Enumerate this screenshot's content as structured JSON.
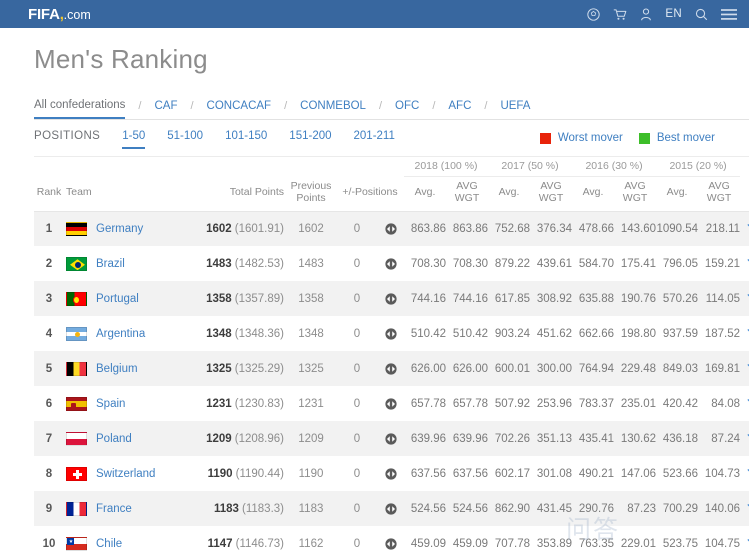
{
  "topbar": {
    "logo_fifa": "FIFA",
    "logo_comma": ",",
    "logo_com": ".com",
    "lang": "EN",
    "icons": [
      "football-icon",
      "cart-icon",
      "account-icon",
      "search-icon",
      "menu-icon"
    ]
  },
  "page": {
    "title": "Men's Ranking"
  },
  "confederations": {
    "separator": "/",
    "items": [
      {
        "label": "All confederations",
        "active": true
      },
      {
        "label": "CAF",
        "active": false
      },
      {
        "label": "CONCACAF",
        "active": false
      },
      {
        "label": "CONMEBOL",
        "active": false
      },
      {
        "label": "OFC",
        "active": false
      },
      {
        "label": "AFC",
        "active": false
      },
      {
        "label": "UEFA",
        "active": false
      }
    ]
  },
  "positions": {
    "label": "POSITIONS",
    "ranges": [
      {
        "label": "1-50",
        "active": true
      },
      {
        "label": "51-100",
        "active": false
      },
      {
        "label": "101-150",
        "active": false
      },
      {
        "label": "151-200",
        "active": false
      },
      {
        "label": "201-211",
        "active": false
      }
    ],
    "worst_mover": "Worst mover",
    "best_mover": "Best mover",
    "worst_color": "#e8230a",
    "best_color": "#3dbe29"
  },
  "table": {
    "year_headers": [
      "2018 (100 %)",
      "2017 (50 %)",
      "2016 (30 %)",
      "2015 (20 %)"
    ],
    "columns": {
      "rank": "Rank",
      "team": "Team",
      "total_points": "Total Points",
      "previous_points": "Previous Points",
      "positions_delta": "+/-Positions",
      "avg": "Avg.",
      "avg_wgt": "AVG WGT"
    },
    "rows": [
      {
        "rank": "1",
        "team": "Germany",
        "points": "1602",
        "points_exact": "(1601.91)",
        "previous": "1602",
        "delta": "0",
        "avg2018": "863.86",
        "wgt2018": "863.86",
        "avg2017": "752.68",
        "wgt2017": "376.34",
        "avg2016": "478.66",
        "wgt2016": "143.60",
        "avg2015": "1090.54",
        "wgt2015": "218.11"
      },
      {
        "rank": "2",
        "team": "Brazil",
        "points": "1483",
        "points_exact": "(1482.53)",
        "previous": "1483",
        "delta": "0",
        "avg2018": "708.30",
        "wgt2018": "708.30",
        "avg2017": "879.22",
        "wgt2017": "439.61",
        "avg2016": "584.70",
        "wgt2016": "175.41",
        "avg2015": "796.05",
        "wgt2015": "159.21"
      },
      {
        "rank": "3",
        "team": "Portugal",
        "points": "1358",
        "points_exact": "(1357.89)",
        "previous": "1358",
        "delta": "0",
        "avg2018": "744.16",
        "wgt2018": "744.16",
        "avg2017": "617.85",
        "wgt2017": "308.92",
        "avg2016": "635.88",
        "wgt2016": "190.76",
        "avg2015": "570.26",
        "wgt2015": "114.05"
      },
      {
        "rank": "4",
        "team": "Argentina",
        "points": "1348",
        "points_exact": "(1348.36)",
        "previous": "1348",
        "delta": "0",
        "avg2018": "510.42",
        "wgt2018": "510.42",
        "avg2017": "903.24",
        "wgt2017": "451.62",
        "avg2016": "662.66",
        "wgt2016": "198.80",
        "avg2015": "937.59",
        "wgt2015": "187.52"
      },
      {
        "rank": "5",
        "team": "Belgium",
        "points": "1325",
        "points_exact": "(1325.29)",
        "previous": "1325",
        "delta": "0",
        "avg2018": "626.00",
        "wgt2018": "626.00",
        "avg2017": "600.01",
        "wgt2017": "300.00",
        "avg2016": "764.94",
        "wgt2016": "229.48",
        "avg2015": "849.03",
        "wgt2015": "169.81"
      },
      {
        "rank": "6",
        "team": "Spain",
        "points": "1231",
        "points_exact": "(1230.83)",
        "previous": "1231",
        "delta": "0",
        "avg2018": "657.78",
        "wgt2018": "657.78",
        "avg2017": "507.92",
        "wgt2017": "253.96",
        "avg2016": "783.37",
        "wgt2016": "235.01",
        "avg2015": "420.42",
        "wgt2015": "84.08"
      },
      {
        "rank": "7",
        "team": "Poland",
        "points": "1209",
        "points_exact": "(1208.96)",
        "previous": "1209",
        "delta": "0",
        "avg2018": "639.96",
        "wgt2018": "639.96",
        "avg2017": "702.26",
        "wgt2017": "351.13",
        "avg2016": "435.41",
        "wgt2016": "130.62",
        "avg2015": "436.18",
        "wgt2015": "87.24"
      },
      {
        "rank": "8",
        "team": "Switzerland",
        "points": "1190",
        "points_exact": "(1190.44)",
        "previous": "1190",
        "delta": "0",
        "avg2018": "637.56",
        "wgt2018": "637.56",
        "avg2017": "602.17",
        "wgt2017": "301.08",
        "avg2016": "490.21",
        "wgt2016": "147.06",
        "avg2015": "523.66",
        "wgt2015": "104.73"
      },
      {
        "rank": "9",
        "team": "France",
        "points": "1183",
        "points_exact": "(1183.3)",
        "previous": "1183",
        "delta": "0",
        "avg2018": "524.56",
        "wgt2018": "524.56",
        "avg2017": "862.90",
        "wgt2017": "431.45",
        "avg2016": "290.76",
        "wgt2016": "87.23",
        "avg2015": "700.29",
        "wgt2015": "140.06"
      },
      {
        "rank": "10",
        "team": "Chile",
        "points": "1147",
        "points_exact": "(1146.73)",
        "previous": "1162",
        "delta": "0",
        "avg2018": "459.09",
        "wgt2018": "459.09",
        "avg2017": "707.78",
        "wgt2017": "353.89",
        "avg2016": "763.35",
        "wgt2016": "229.01",
        "avg2015": "523.75",
        "wgt2015": "104.75"
      }
    ]
  },
  "watermark": "问答"
}
